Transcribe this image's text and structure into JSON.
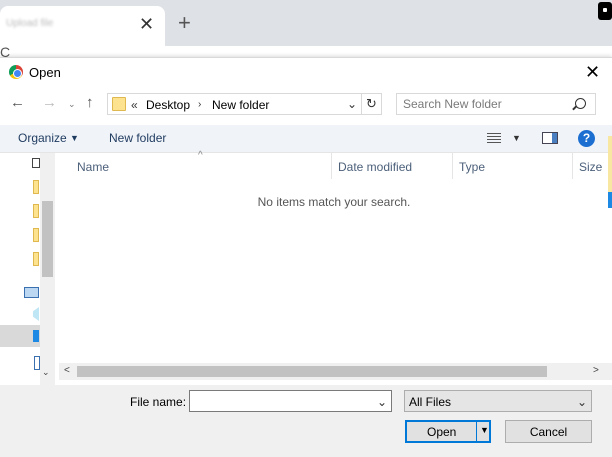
{
  "browser": {
    "tab_title": "Upload file",
    "tab_close": "✕",
    "new_tab": "+",
    "reload": "C"
  },
  "dialog": {
    "title": "Open",
    "close": "✕"
  },
  "nav": {
    "back": "←",
    "forward": "→",
    "recent": "⌄",
    "up": "↑",
    "address": {
      "overflow": "«",
      "crumbs": [
        "Desktop",
        "New folder"
      ],
      "separator": "›",
      "dropdown": "⌄"
    },
    "refresh": "↻",
    "search_placeholder": "Search New folder"
  },
  "commands": {
    "organize": "Organize",
    "organize_arrow": "▼",
    "new_folder": "New folder",
    "view_arrow": "▼",
    "help": "?"
  },
  "file_list": {
    "sort_arrow": "^",
    "columns": [
      "Name",
      "Date modified",
      "Type",
      "Size"
    ],
    "empty_message": "No items match your search.",
    "scroll_left": "<",
    "scroll_right": ">"
  },
  "nav_pane": {
    "scroll_down": "⌄"
  },
  "bottom": {
    "file_name_label": "File name:",
    "file_name_value": "",
    "file_name_dropdown": "⌄",
    "file_type": "All Files",
    "file_type_dropdown": "⌄",
    "open_label": "Open",
    "open_dropdown": "▼",
    "cancel_label": "Cancel"
  },
  "colors": {
    "accent": "#0078d7",
    "command_text": "#1e3a5f",
    "help_blue": "#1c6fd1"
  }
}
